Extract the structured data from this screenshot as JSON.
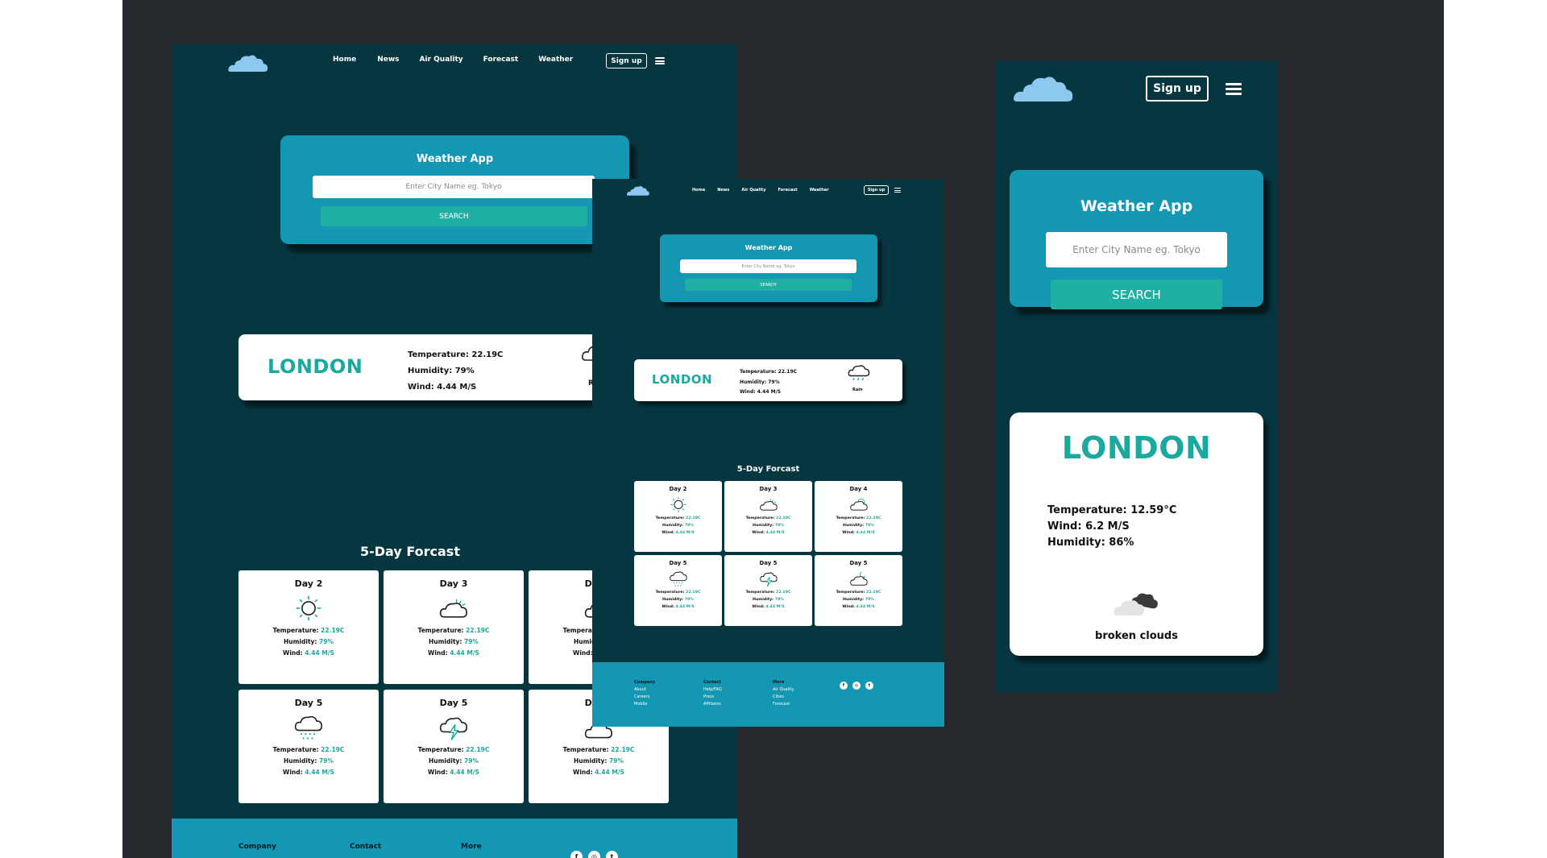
{
  "nav": {
    "home": "Home",
    "news": "News",
    "air_quality": "Air Quality",
    "forecast": "Forecast",
    "weather": "Weather",
    "signup": "Sign up"
  },
  "search": {
    "title": "Weather App",
    "placeholder": "Enter City Name eg. Tokyo",
    "button": "SEARCH"
  },
  "current": {
    "city": "LONDON",
    "temperature": "Temperature: 22.19C",
    "humidity": "Humidity: 79%",
    "wind": "Wind: 4.44 M/S",
    "condition": "Rain",
    "condition_clipped": "R"
  },
  "forecast": {
    "title": "5-Day Forcast",
    "temp_label": "Temperature:",
    "temp_value": "22.19C",
    "hum_label": "Humidity:",
    "hum_value": "79%",
    "wind_label": "Wind:",
    "wind_value": "4.44 M/S",
    "days": [
      "Day 2",
      "Day 3",
      "Day 4",
      "Day 5",
      "Day 5",
      "Day 5"
    ],
    "icons": [
      "sun-icon",
      "cloud-icon",
      "partly-cloudy-icon",
      "snow-cloud-icon",
      "thunder-cloud-icon",
      "cloudy-night-icon"
    ]
  },
  "footer": {
    "company": {
      "heading": "Company",
      "links": [
        "About",
        "Careers",
        "Mobile"
      ]
    },
    "contact": {
      "heading": "Contact",
      "links": [
        "Help/FAQ",
        "Press",
        "Affiliates"
      ]
    },
    "more": {
      "heading": "More",
      "links": [
        "Air Quality",
        "Cities",
        "Forecast"
      ]
    },
    "social": [
      "f",
      "◎",
      "t"
    ]
  },
  "mobile": {
    "city": "LONDON",
    "temperature": "Temperature: 12.59°C",
    "wind": "Wind: 6.2 M/S",
    "humidity": "Humidity: 86%",
    "condition": "broken clouds"
  },
  "colors": {
    "page_bg": "#063741",
    "accent": "#1397b3",
    "button": "#1fb0a3",
    "city_text": "#1aa99e",
    "logo": "#8cc8ef"
  }
}
